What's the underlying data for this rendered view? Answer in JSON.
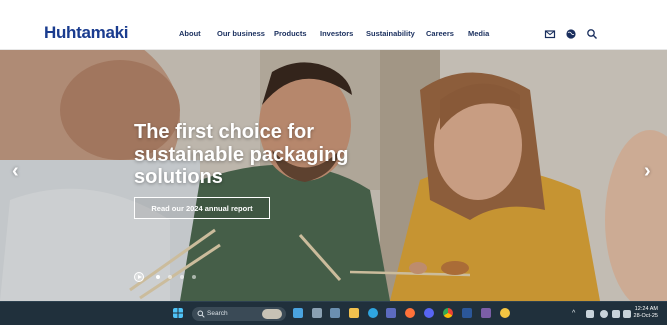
{
  "header": {
    "logo": "Huhtamaki",
    "nav": [
      "About",
      "Our business",
      "Products",
      "Investors",
      "Sustainability",
      "Careers",
      "Media"
    ],
    "icons": [
      "mail-icon",
      "globe-icon",
      "search-icon"
    ]
  },
  "hero": {
    "headline": "The first choice for sustainable packaging solutions",
    "cta_label": "Read our 2024 annual report",
    "prev_arrow": "‹",
    "next_arrow": "›",
    "slide_count": 4,
    "active_slide": 1
  },
  "taskbar": {
    "search_placeholder": "Search",
    "time": "12:24 AM",
    "date": "28-Oct-25",
    "tray_chevron": "^",
    "app_icons": [
      "windows-start-icon",
      "task-view-icon",
      "file-explorer-icon",
      "edge-icon",
      "store-icon",
      "chrome-icon",
      "firefox-icon",
      "discord-icon",
      "word-icon",
      "app-icon"
    ]
  },
  "colors": {
    "brand_blue": "#1a3c8f",
    "nav_text": "#1a2f5e",
    "taskbar_bg": "#20303c"
  }
}
